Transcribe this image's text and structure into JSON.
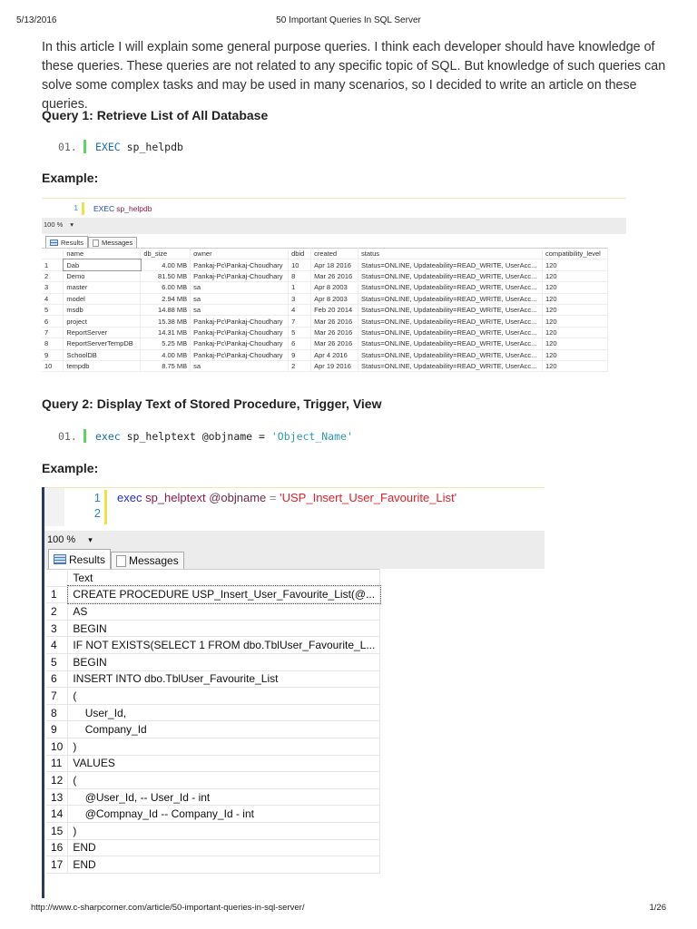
{
  "header": {
    "date": "5/13/2016",
    "title": "50 Important Queries In SQL Server"
  },
  "intro": "In this article I will explain some general purpose queries. I think each developer should have knowledge of these queries. These queries are not related to any specific topic of SQL. But knowledge of such queries can solve some complex tasks and may be used in many scenarios, so I decided to write an article on these queries.",
  "query1": {
    "heading": "Query 1: Retrieve List of All Database",
    "line_no": "01.",
    "keyword": "EXEC",
    "rest": " sp_helpdb",
    "example": "Example:"
  },
  "shot1": {
    "gutter": "1",
    "kw": "EXEC",
    "proc": "sp_helpdb",
    "zoom": "100 %",
    "tab_results": "Results",
    "tab_messages": "Messages",
    "columns": [
      "",
      "name",
      "db_size",
      "owner",
      "dbid",
      "created",
      "status",
      "compatibility_level"
    ],
    "rows": [
      [
        "1",
        "Dab",
        "4.00 MB",
        "Pankaj-Pc\\Pankaj-Choudhary",
        "10",
        "Apr 18 2016",
        "Status=ONLINE, Updateability=READ_WRITE, UserAcc...",
        "120"
      ],
      [
        "2",
        "Demo",
        "81.50 MB",
        "Pankaj-Pc\\Pankaj-Choudhary",
        "8",
        "Mar 26 2016",
        "Status=ONLINE, Updateability=READ_WRITE, UserAcc...",
        "120"
      ],
      [
        "3",
        "master",
        "6.00 MB",
        "sa",
        "1",
        "Apr 8 2003",
        "Status=ONLINE, Updateability=READ_WRITE, UserAcc...",
        "120"
      ],
      [
        "4",
        "model",
        "2.94 MB",
        "sa",
        "3",
        "Apr 8 2003",
        "Status=ONLINE, Updateability=READ_WRITE, UserAcc...",
        "120"
      ],
      [
        "5",
        "msdb",
        "14.88 MB",
        "sa",
        "4",
        "Feb 20 2014",
        "Status=ONLINE, Updateability=READ_WRITE, UserAcc...",
        "120"
      ],
      [
        "6",
        "project",
        "15.38 MB",
        "Pankaj-Pc\\Pankaj-Choudhary",
        "7",
        "Mar 26 2016",
        "Status=ONLINE, Updateability=READ_WRITE, UserAcc...",
        "120"
      ],
      [
        "7",
        "ReportServer",
        "14.31 MB",
        "Pankaj-Pc\\Pankaj-Choudhary",
        "5",
        "Mar 26 2016",
        "Status=ONLINE, Updateability=READ_WRITE, UserAcc...",
        "120"
      ],
      [
        "8",
        "ReportServerTempDB",
        "5.25 MB",
        "Pankaj-Pc\\Pankaj-Choudhary",
        "6",
        "Mar 26 2016",
        "Status=ONLINE, Updateability=READ_WRITE, UserAcc...",
        "120"
      ],
      [
        "9",
        "SchoolDB",
        "4.00 MB",
        "Pankaj-Pc\\Pankaj-Choudhary",
        "9",
        "Apr 4 2016",
        "Status=ONLINE, Updateability=READ_WRITE, UserAcc...",
        "120"
      ],
      [
        "10",
        "tempdb",
        "8.75 MB",
        "sa",
        "2",
        "Apr 19 2016",
        "Status=ONLINE, Updateability=READ_WRITE, UserAcc...",
        "120"
      ]
    ]
  },
  "query2": {
    "heading": "Query 2: Display Text of Stored Procedure, Trigger, View",
    "line_no": "01.",
    "keyword": "exec",
    "rest": " sp_helptext @objname = ",
    "string": "'Object_Name'",
    "example": "Example:"
  },
  "shot2": {
    "line1": "1",
    "line2": "2",
    "kw": "exec",
    "proc": "sp_helptext",
    "param": "@objname",
    "eq": "=",
    "str": "'USP_Insert_User_Favourite_List'",
    "zoom": "100 %",
    "tab_results": "Results",
    "tab_messages": "Messages",
    "column": "Text",
    "rows": [
      [
        "1",
        "CREATE PROCEDURE USP_Insert_User_Favourite_List(@..."
      ],
      [
        "2",
        "AS"
      ],
      [
        "3",
        "BEGIN"
      ],
      [
        "4",
        "IF NOT EXISTS(SELECT 1 FROM dbo.TblUser_Favourite_L..."
      ],
      [
        "5",
        "BEGIN"
      ],
      [
        "6",
        "INSERT INTO dbo.TblUser_Favourite_List"
      ],
      [
        "7",
        "("
      ],
      [
        "8",
        "    User_Id,"
      ],
      [
        "9",
        "    Company_Id"
      ],
      [
        "10",
        ")"
      ],
      [
        "11",
        "VALUES"
      ],
      [
        "12",
        "("
      ],
      [
        "13",
        "    @User_Id, -- User_Id - int"
      ],
      [
        "14",
        "    @Compnay_Id -- Company_Id - int"
      ],
      [
        "15",
        ")"
      ],
      [
        "16",
        "END"
      ],
      [
        "17",
        "END"
      ]
    ]
  },
  "footer": {
    "url": "http://www.c-sharpcorner.com/article/50-important-queries-in-sql-server/",
    "page": "1/26"
  }
}
